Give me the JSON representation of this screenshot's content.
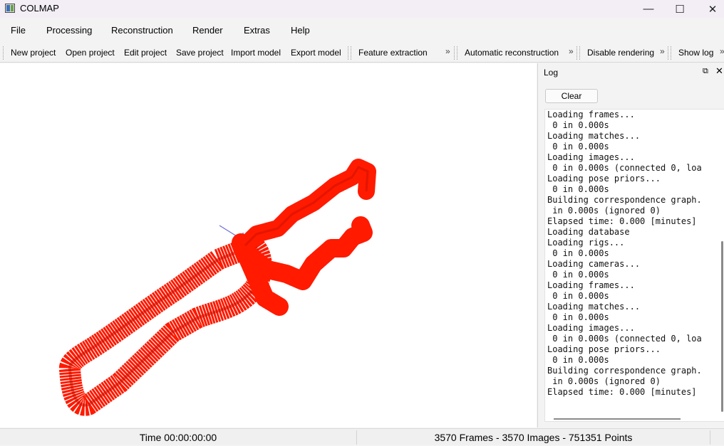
{
  "window": {
    "title": "COLMAP",
    "minimize_glyph": "—",
    "maximize_glyph": "☐",
    "close_glyph": "✕"
  },
  "menu": [
    "File",
    "Processing",
    "Reconstruction",
    "Render",
    "Extras",
    "Help"
  ],
  "toolbar": {
    "groups": [
      [
        "New project",
        "Open project",
        "Edit project",
        "Save project",
        "Import model",
        "Export model"
      ],
      [
        "Feature extraction"
      ],
      [
        "Automatic reconstruction"
      ],
      [
        "Disable rendering"
      ],
      [
        "Show log"
      ]
    ],
    "overflow_glyph": "»"
  },
  "log_panel": {
    "title": "Log",
    "clear_label": "Clear",
    "float_glyph": "⧉",
    "close_glyph": "✕",
    "lines": [
      "Loading frames...",
      " 0 in 0.000s",
      "Loading matches...",
      " 0 in 0.000s",
      "Loading images...",
      " 0 in 0.000s (connected 0, loa",
      "Loading pose priors...",
      " 0 in 0.000s",
      "Building correspondence graph.",
      " in 0.000s (ignored 0)",
      "Elapsed time: 0.000 [minutes]",
      "Loading database",
      "Loading rigs...",
      " 0 in 0.000s",
      "Loading cameras...",
      " 0 in 0.000s",
      "Loading frames...",
      " 0 in 0.000s",
      "Loading matches...",
      " 0 in 0.000s",
      "Loading images...",
      " 0 in 0.000s (connected 0, loa",
      "Loading pose priors...",
      " 0 in 0.000s",
      "Building correspondence graph.",
      " in 0.000s (ignored 0)",
      "Elapsed time: 0.000 [minutes]"
    ]
  },
  "status": {
    "time": "Time 00:00:00:00",
    "summary": "3570 Frames - 3570 Images - 751351 Points"
  },
  "colors": {
    "reconstruction": "#ff1a00",
    "reconstruction_dark": "#c80f00",
    "axis": "#7070d8"
  }
}
